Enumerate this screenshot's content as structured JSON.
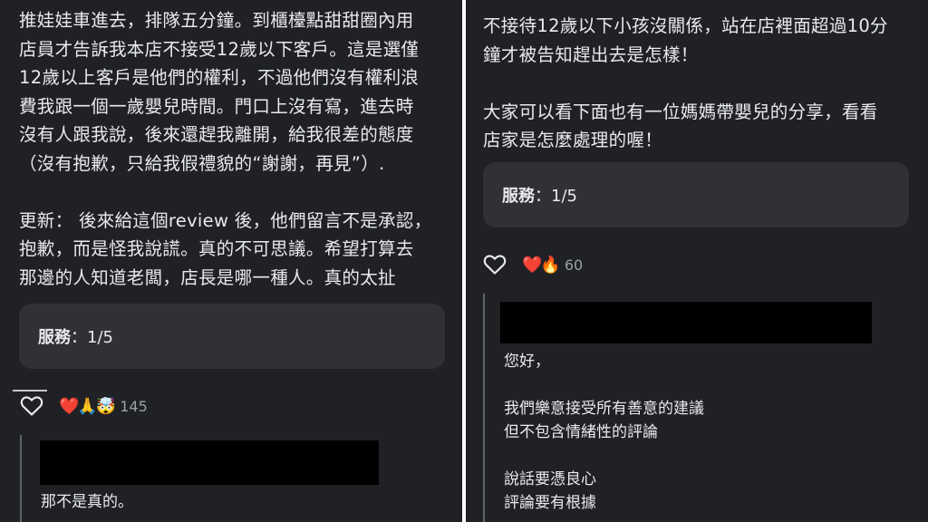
{
  "left": {
    "review_text": "推娃娃車進去，排隊五分鐘。到櫃檯點甜甜圈內用\n店員才告訴我本店不接受12歲以下客戶。這是選僅\n12歲以上客戶是他們的權利，不過他們沒有權利浪\n費我跟一個一歲嬰兒時間。門口上沒有寫，進去時\n沒有人跟我說，後來還趕我離開，給我很差的態度\n（沒有抱歉，只給我假禮貌的“謝謝，再見”）.\n\n更新： 後來給這個review 後，他們留言不是承認，\n抱歉，而是怪我說謊。真的不可思議。希望打算去\n那邊的人知道老闆，店長是哪一種人。真的太扯",
    "rating_label": "服務",
    "rating_value": "：1/5",
    "reaction_emojis": "❤️🙏🤯",
    "reaction_count": "145",
    "reply_text": "那不是真的。"
  },
  "right": {
    "review_text": "不接待12歲以下小孩沒關係，站在店裡面超過10分\n鐘才被告知趕出去是怎樣！\n\n大家可以看下面也有一位媽媽帶嬰兒的分享，看看\n店家是怎麼處理的喔！",
    "rating_label": "服務",
    "rating_value": "：1/5",
    "reaction_emojis": "❤️🔥",
    "reaction_count": "60",
    "reply_text": "您好，\n\n我們樂意接受所有善意的建議\n但不包含情緒性的評論\n\n說話要憑良心\n評論要有根據"
  },
  "colors": {
    "background": "#202124",
    "card": "#303134",
    "text": "#e8eaed",
    "muted": "#9aa0a6",
    "redaction": "#000000"
  },
  "icons": {
    "like": "heart-outline-icon"
  }
}
